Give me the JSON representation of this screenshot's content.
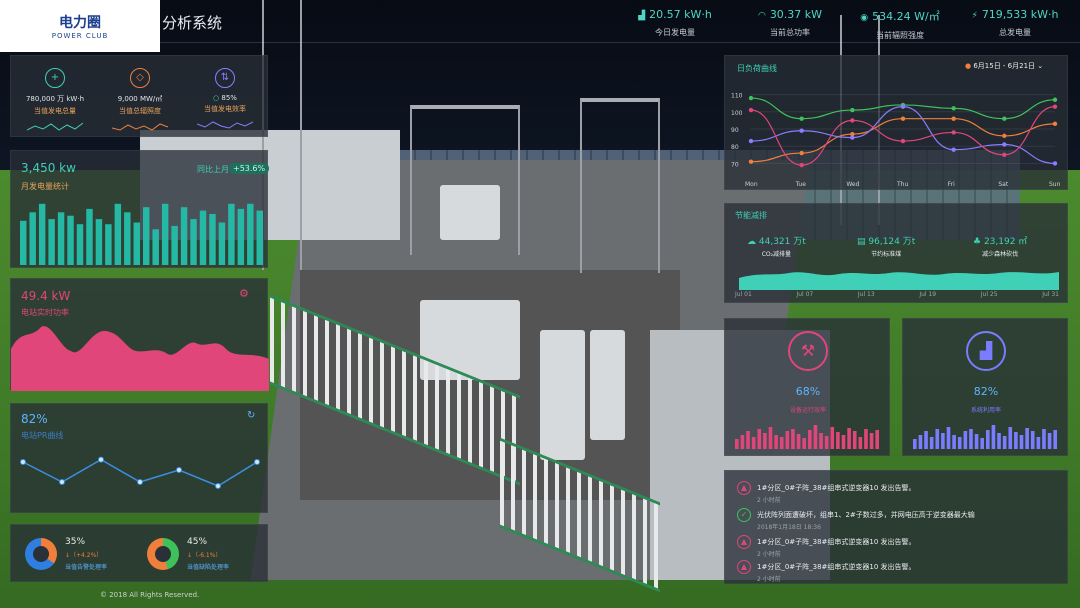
{
  "header": {
    "logo_text": "电力圈",
    "logo_sub": "POWER CLUB",
    "title": "分析系统",
    "kpis": [
      {
        "value": "20.57 kW·h",
        "label": "今日发电量",
        "icon": "chart-icon"
      },
      {
        "value": "30.37 kW",
        "label": "当前总功率",
        "icon": "gauge-icon"
      },
      {
        "value": "534.24 W/㎡",
        "label": "当前辐照强度",
        "icon": "sun-icon"
      },
      {
        "value": "719,533 kW·h",
        "label": "总发电量",
        "icon": "bolt-icon"
      }
    ]
  },
  "left": {
    "top_stats": [
      {
        "value": "780,000 万 kW·h",
        "label": "当值发电总量",
        "color": "#3fd0b7",
        "icon": "plus-icon"
      },
      {
        "value": "9,000 MW/㎡",
        "label": "当值总辐照度",
        "color": "#f07f3c",
        "icon": "radiation-icon"
      },
      {
        "value": "85%",
        "label": "当值发电效率",
        "color": "#8a7dff",
        "icon": "efficiency-icon",
        "prefix": "○"
      }
    ],
    "monthly": {
      "value": "3,450 kw",
      "label": "月发电量统计",
      "compare_label": "同比上月",
      "compare_value": "+53.6%",
      "bars": [
        26,
        31,
        36,
        27,
        31,
        29,
        24,
        33,
        27,
        24,
        36,
        31,
        25,
        34,
        21,
        36,
        23,
        34,
        27,
        32,
        30,
        25,
        36,
        33,
        36,
        32
      ]
    },
    "power": {
      "value": "49.4 kW",
      "label": "电站实时功率"
    },
    "pr": {
      "value": "82%",
      "label": "电站PR曲线",
      "points": [
        55,
        30,
        58,
        30,
        45,
        25,
        55
      ]
    },
    "rates": [
      {
        "value": "35%",
        "delta": "↓（+4.2%）",
        "label": "当值告警处理率",
        "color": "#f07f3c"
      },
      {
        "value": "45%",
        "delta": "↓（-6.1%）",
        "label": "当值缺陷处理率",
        "color": "#f07f3c"
      }
    ],
    "copyright": "© 2018 All Rights Reserved."
  },
  "right": {
    "load": {
      "title": "日负荷曲线",
      "range": "6月15日 - 6月21日",
      "days": [
        "Mon",
        "Tue",
        "Wed",
        "Thu",
        "Fri",
        "Sat",
        "Sun"
      ],
      "yticks": [
        "110",
        "100",
        "90",
        "80",
        "70"
      ],
      "series": [
        {
          "color": "#3fc15a",
          "values": [
            108,
            96,
            101,
            104,
            102,
            96,
            107
          ]
        },
        {
          "color": "#f07f3c",
          "values": [
            71,
            76,
            87,
            96,
            96,
            86,
            93
          ]
        },
        {
          "color": "#8a7dff",
          "values": [
            83,
            89,
            85,
            103,
            78,
            81,
            70
          ]
        },
        {
          "color": "#e0467a",
          "values": [
            101,
            69,
            95,
            83,
            88,
            75,
            103
          ]
        }
      ]
    },
    "energy": {
      "title": "节能减排",
      "stats": [
        {
          "value": "44,321 万t",
          "label": "CO₂减排量"
        },
        {
          "value": "96,124 万t",
          "label": "节约标准煤"
        },
        {
          "value": "23,192 ㎡",
          "label": "减少森林砍伐"
        }
      ],
      "xlabels": [
        "Jul 01",
        "Jul 07",
        "Jul 13",
        "Jul 19",
        "Jul 25",
        "Jul 31"
      ]
    },
    "gauges": [
      {
        "value": "68%",
        "label": "设备运行效率",
        "color": "#e0467a",
        "icon": "wrench-icon"
      },
      {
        "value": "82%",
        "label": "系统利用率",
        "color": "#7a7dff",
        "icon": "chart-icon"
      }
    ],
    "events": [
      {
        "text": "1#分区_0#子阵_38#组串式逆变器10 发出告警。",
        "time": "2 小时前",
        "type": "alarm"
      },
      {
        "text": "光伏阵列面遭破坏，组串1、2#子数过多，并网电压高于逆变器最大输",
        "time": "2018年1月18日 18:36",
        "type": "ok"
      },
      {
        "text": "1#分区_0#子阵_38#组串式逆变器10 发出告警。",
        "time": "2 小时前",
        "type": "alarm"
      },
      {
        "text": "1#分区_0#子阵_38#组串式逆变器10 发出告警。",
        "time": "2 小时前",
        "type": "alarm"
      }
    ]
  }
}
